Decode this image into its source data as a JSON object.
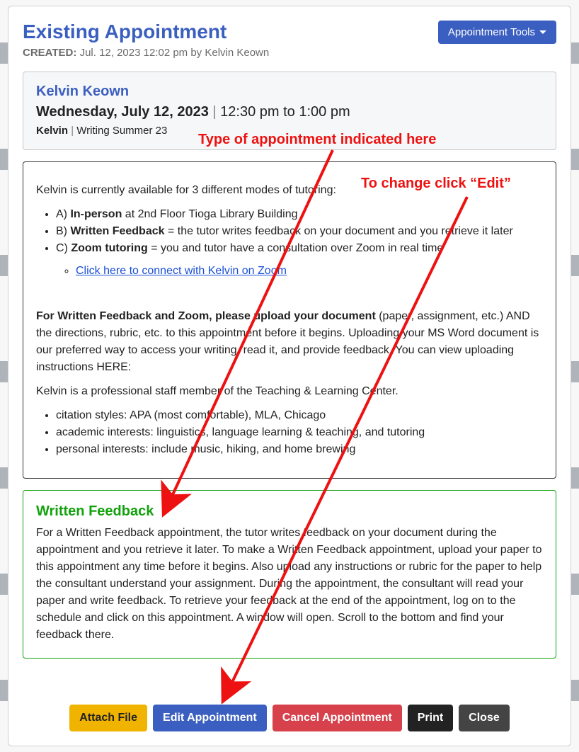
{
  "header": {
    "title": "Existing Appointment",
    "tools_button": "Appointment Tools",
    "created_label": "CREATED:",
    "created_value": "Jul. 12, 2023 12:02 pm by Kelvin Keown"
  },
  "info": {
    "person": "Kelvin Keown",
    "date_bold": "Wednesday, July 12, 2023",
    "time": "12:30 pm to 1:00 pm",
    "tutor_name": "Kelvin",
    "course": "Writing Summer 23"
  },
  "details": {
    "intro": "Kelvin is currently available for 3 different modes of tutoring:",
    "mode_a_prefix": "A) ",
    "mode_a_bold": "In-person",
    "mode_a_rest": " at 2nd Floor Tioga Library Building",
    "mode_b_prefix": "B) ",
    "mode_b_bold": "Written Feedback",
    "mode_b_rest": " = the tutor writes feedback on your document and you retrieve it later",
    "mode_c_prefix": "C) ",
    "mode_c_bold": "Zoom tutoring",
    "mode_c_rest": " = you and tutor have a consultation over Zoom in real time",
    "zoom_link_text": "Click here to connect with Kelvin on Zoom",
    "upload_bold": "For Written Feedback and Zoom, please upload your document",
    "upload_rest": " (paper, assignment, etc.) AND the directions, rubric, etc. to this appointment before it begins. Uploading your MS Word document is our preferred way to access your writing, read it, and provide feedback. You can view uploading instructions HERE:",
    "staff_line": "Kelvin is a professional staff member of the Teaching & Learning Center.",
    "bullets": [
      "citation styles: APA (most comfortable), MLA, Chicago",
      "academic interests: linguistics, language learning & teaching, and tutoring",
      "personal interests: include music, hiking, and home brewing"
    ]
  },
  "written_feedback": {
    "title": "Written Feedback",
    "body": "For a Written Feedback appointment, the tutor writes feedback on your document during the appointment and you retrieve it later. To make a Written Feedback appointment, upload your paper to this appointment any time before it begins. Also upload any instructions or rubric for the paper to help the consultant understand your assignment. During the appointment, the consultant will read your paper and write feedback. To retrieve your feedback at the end of the appointment, log on to the schedule and click on this appointment. A window will open. Scroll to the bottom and find your feedback there."
  },
  "footer": {
    "attach": "Attach File",
    "edit": "Edit Appointment",
    "cancel": "Cancel Appointment",
    "print": "Print",
    "close": "Close"
  },
  "annotations": {
    "type_here": "Type of appointment indicated here",
    "to_change": "To change click “Edit”"
  }
}
